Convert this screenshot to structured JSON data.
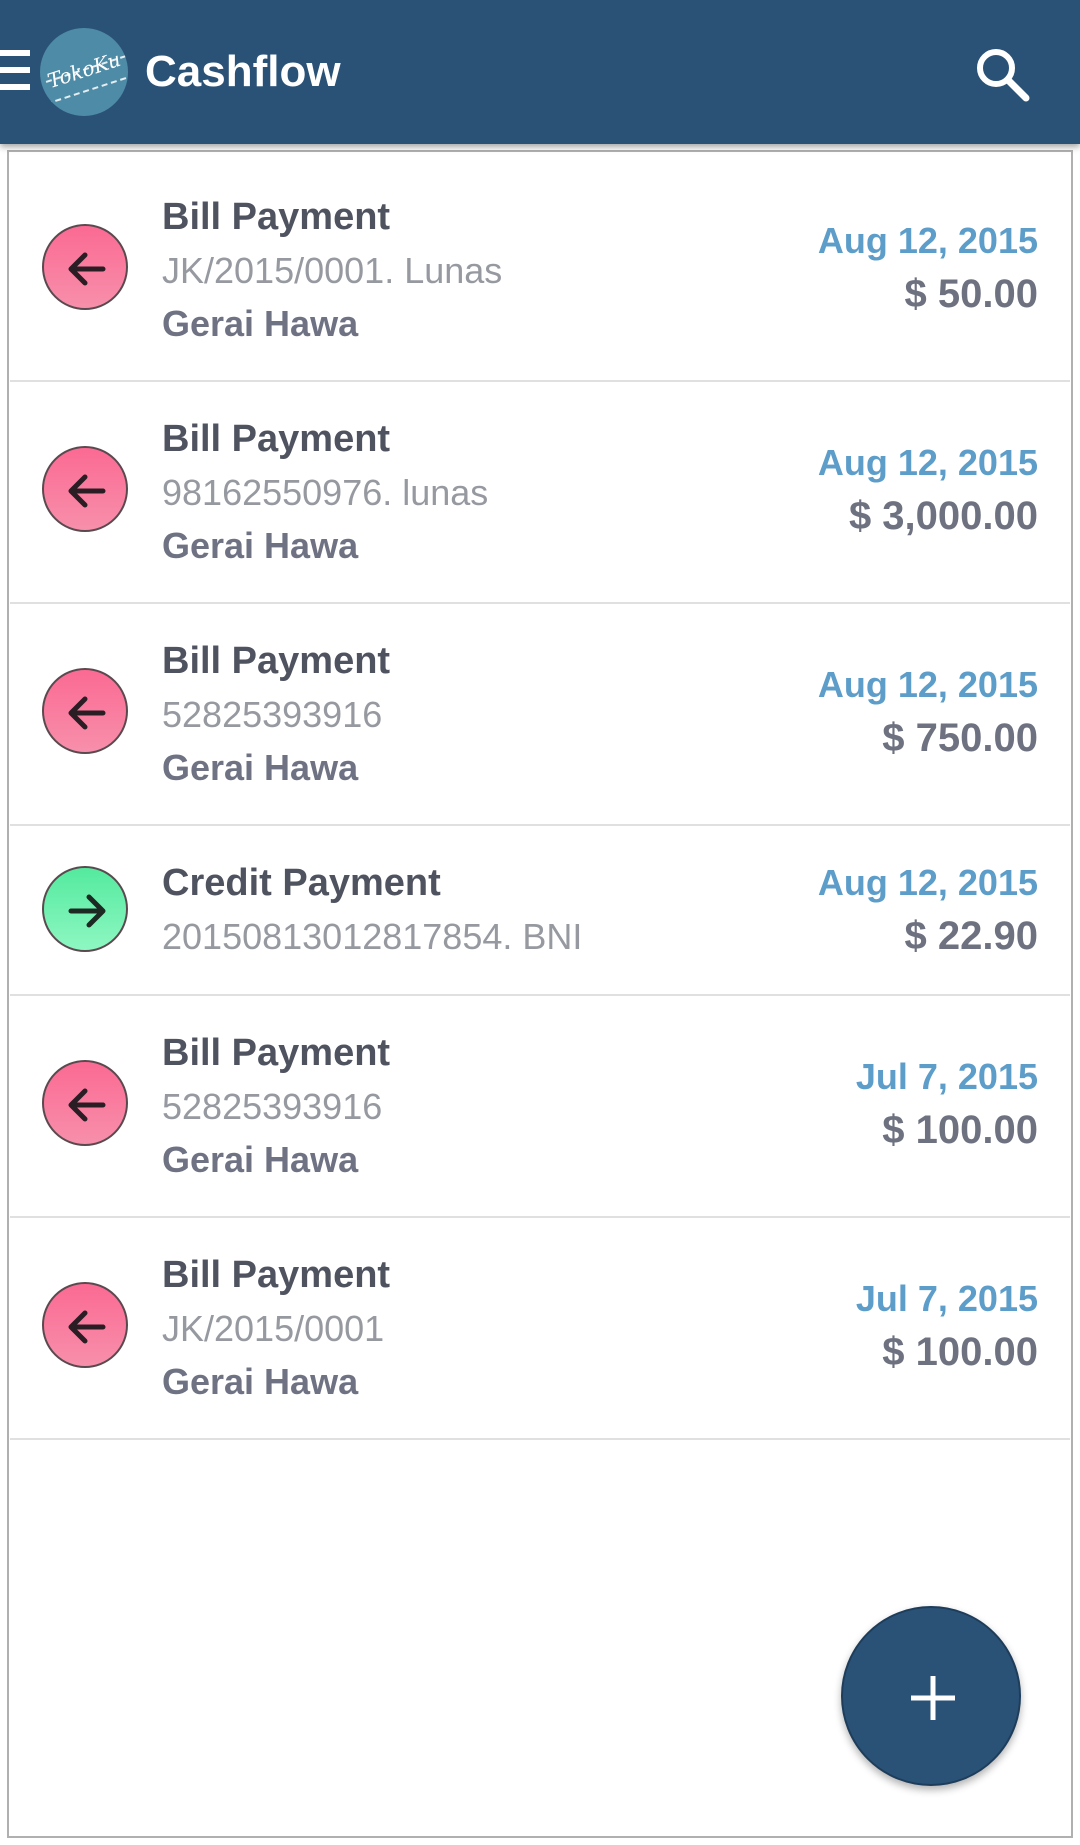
{
  "app": {
    "title": "Cashflow",
    "logo_text": "TokoKu",
    "icons": {
      "menu": "hamburger-menu-icon",
      "search": "search-icon",
      "add": "plus-icon"
    },
    "colors": {
      "appbar": "#2a5277",
      "debit": "#fb6a93",
      "credit": "#54ea9e",
      "date": "#5d9dc9"
    }
  },
  "transactions": [
    {
      "type": "debit",
      "icon": "arrow-left-icon",
      "title": "Bill Payment",
      "reference": "JK/2015/0001. Lunas",
      "party": "Gerai Hawa",
      "date": "Aug 12, 2015",
      "amount": "$ 50.00"
    },
    {
      "type": "debit",
      "icon": "arrow-left-icon",
      "title": "Bill Payment",
      "reference": "98162550976. lunas",
      "party": "Gerai Hawa",
      "date": "Aug 12, 2015",
      "amount": "$ 3,000.00"
    },
    {
      "type": "debit",
      "icon": "arrow-left-icon",
      "title": "Bill Payment",
      "reference": "52825393916",
      "party": "Gerai Hawa",
      "date": "Aug 12, 2015",
      "amount": "$ 750.00"
    },
    {
      "type": "credit",
      "icon": "arrow-right-icon",
      "title": "Credit Payment",
      "reference": "20150813012817854. BNI",
      "date": "Aug 12, 2015",
      "amount": "$ 22.90"
    },
    {
      "type": "debit",
      "icon": "arrow-left-icon",
      "title": "Bill Payment",
      "reference": "52825393916",
      "party": "Gerai Hawa",
      "date": "Jul 7, 2015",
      "amount": "$ 100.00"
    },
    {
      "type": "debit",
      "icon": "arrow-left-icon",
      "title": "Bill Payment",
      "reference": "JK/2015/0001",
      "party": "Gerai Hawa",
      "date": "Jul 7, 2015",
      "amount": "$ 100.00"
    }
  ]
}
